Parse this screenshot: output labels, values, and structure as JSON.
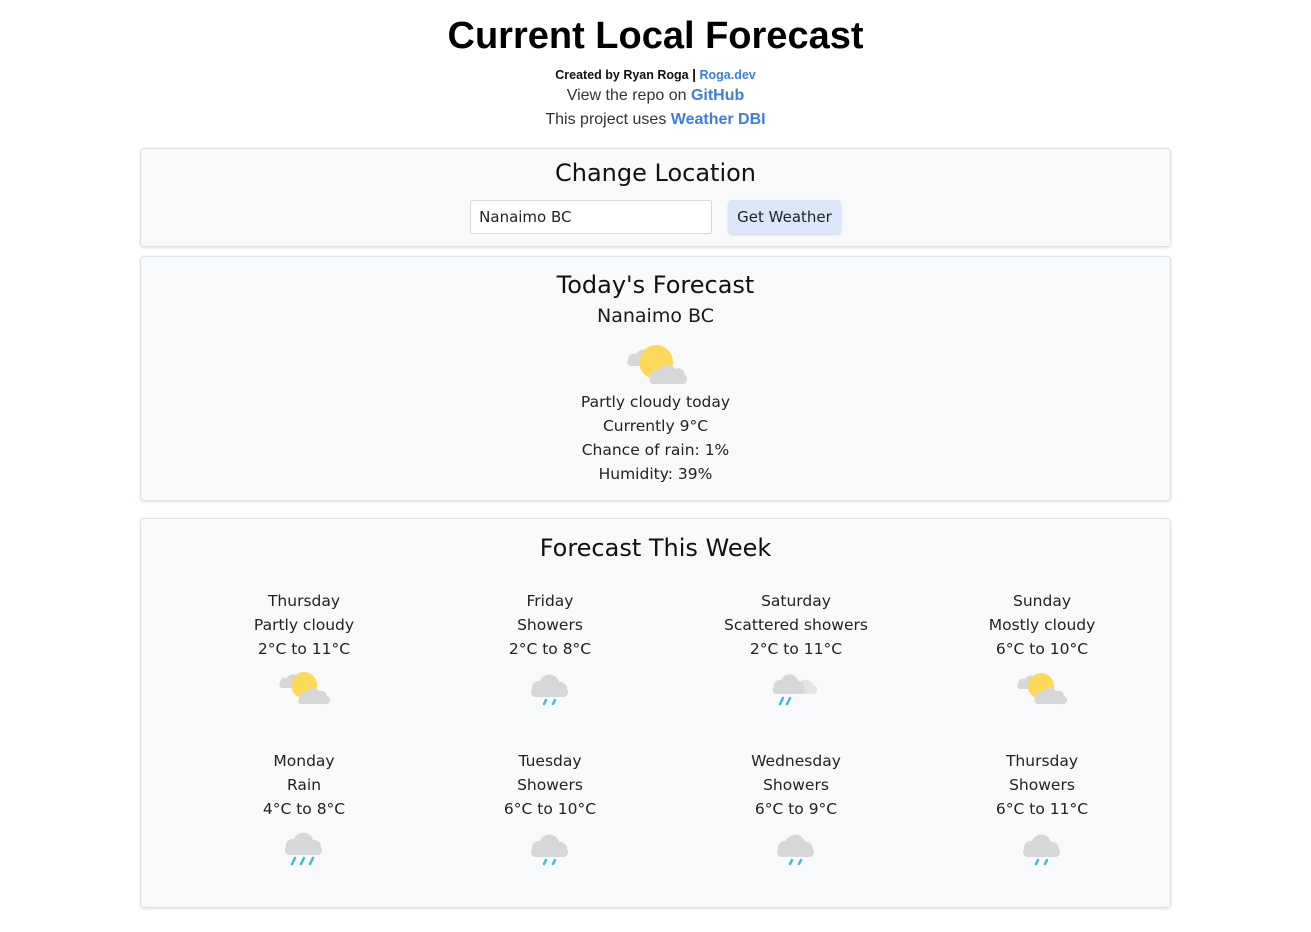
{
  "header": {
    "title": "Current Local Forecast",
    "credit_prefix": "Created by Ryan Roga",
    "credit_link": "Roga.dev",
    "repo_prefix": "View the repo on",
    "repo_link": "GitHub",
    "api_prefix": "This project uses",
    "api_link": "Weather DBI"
  },
  "location": {
    "heading": "Change Location",
    "input_value": "Nanaimo BC",
    "button_label": "Get Weather"
  },
  "today": {
    "heading": "Today's Forecast",
    "city": "Nanaimo BC",
    "icon": "partly-cloudy-icon",
    "summary": "Partly cloudy today",
    "current": "Currently 9°C",
    "rain": "Chance of rain: 1%",
    "humidity": "Humidity: 39%"
  },
  "week": {
    "heading": "Forecast This Week",
    "days": [
      {
        "day": "Thursday",
        "condition": "Partly cloudy",
        "range": "2°C to 11°C",
        "icon": "partly-cloudy-icon"
      },
      {
        "day": "Friday",
        "condition": "Showers",
        "range": "2°C to 8°C",
        "icon": "showers-icon"
      },
      {
        "day": "Saturday",
        "condition": "Scattered showers",
        "range": "2°C to 11°C",
        "icon": "scattered-showers-icon"
      },
      {
        "day": "Sunday",
        "condition": "Mostly cloudy",
        "range": "6°C to 10°C",
        "icon": "mostly-cloudy-icon"
      },
      {
        "day": "Monday",
        "condition": "Rain",
        "range": "4°C to 8°C",
        "icon": "rain-icon"
      },
      {
        "day": "Tuesday",
        "condition": "Showers",
        "range": "6°C to 10°C",
        "icon": "showers-icon"
      },
      {
        "day": "Wednesday",
        "condition": "Showers",
        "range": "6°C to 9°C",
        "icon": "showers-icon"
      },
      {
        "day": "Thursday",
        "condition": "Showers",
        "range": "6°C to 11°C",
        "icon": "showers-icon"
      }
    ]
  },
  "colors": {
    "link": "#3d7de0",
    "card_bg": "#f8f9fb",
    "button_bg": "#dbe7f9",
    "sun": "#fcd958",
    "cloud": "#d6d7d9",
    "rain": "#42b9d6"
  }
}
